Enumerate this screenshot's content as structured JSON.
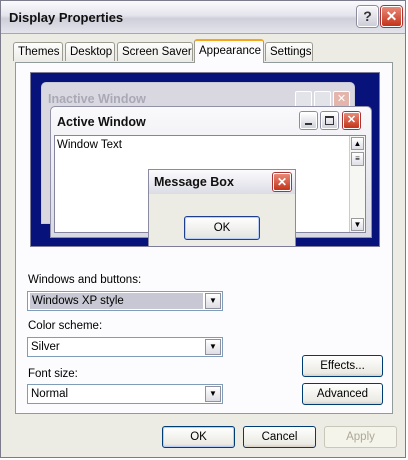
{
  "window": {
    "title": "Display Properties"
  },
  "tabs": [
    "Themes",
    "Desktop",
    "Screen Saver",
    "Appearance",
    "Settings"
  ],
  "active_tab": "Appearance",
  "preview": {
    "inactive_title": "Inactive Window",
    "active_title": "Active Window",
    "window_text": "Window Text",
    "message_box_title": "Message Box",
    "message_box_ok": "OK"
  },
  "fields": {
    "windows_buttons": {
      "label": "Windows and buttons:",
      "value": "Windows XP style"
    },
    "color_scheme": {
      "label": "Color scheme:",
      "value": "Silver"
    },
    "font_size": {
      "label": "Font size:",
      "value": "Normal"
    }
  },
  "buttons": {
    "effects": "Effects...",
    "advanced": "Advanced",
    "ok": "OK",
    "cancel": "Cancel",
    "apply": "Apply"
  },
  "colors": {
    "preview_desktop": "#07137a",
    "tab_highlight": "#f5a61c",
    "close_button": "#c4331a"
  }
}
